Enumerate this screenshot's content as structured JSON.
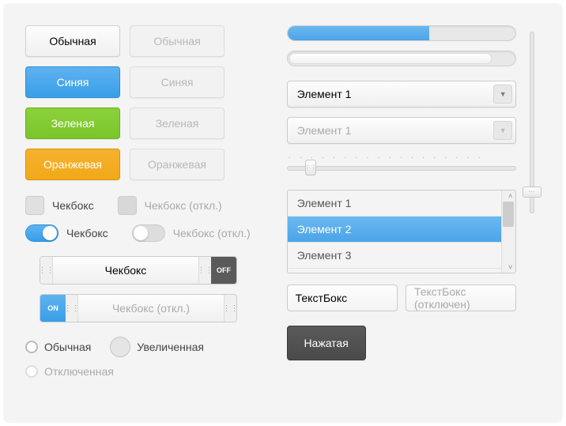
{
  "buttons": {
    "default": {
      "enabled": "Обычная",
      "disabled": "Обычная"
    },
    "blue": {
      "enabled": "Синяя",
      "disabled": "Синяя"
    },
    "green": {
      "enabled": "Зеленая",
      "disabled": "Зеленая"
    },
    "orange": {
      "enabled": "Оранжевая",
      "disabled": "Оранжевая"
    },
    "pressed": "Нажатая"
  },
  "checkboxes": {
    "enabled_label": "Чекбокс",
    "disabled_label": "Чекбокс (откл.)"
  },
  "toggles": {
    "enabled_label": "Чекбокс",
    "disabled_label": "Чекбокс (откл.)"
  },
  "big_toggles": {
    "off_label": "Чекбокс",
    "off_cap": "OFF",
    "on_label": "Чекбокс (откл.)",
    "on_cap": "ON"
  },
  "radios": {
    "normal": "Обычная",
    "large": "Увеличенная",
    "disabled": "Отключенная"
  },
  "progress": {
    "value": 62
  },
  "selects": {
    "enabled_value": "Элемент 1",
    "disabled_value": "Элемент 1"
  },
  "listbox": {
    "items": [
      "Элемент 1",
      "Элемент 2",
      "Элемент 3"
    ],
    "selected_index": 1
  },
  "textboxes": {
    "enabled_value": "ТекстБокс",
    "disabled_value": "ТекстБокс (отключен)"
  },
  "colors": {
    "blue": "#4ba4e8",
    "green": "#7bc52a",
    "orange": "#f1a91a",
    "dark": "#4a4a4a"
  }
}
